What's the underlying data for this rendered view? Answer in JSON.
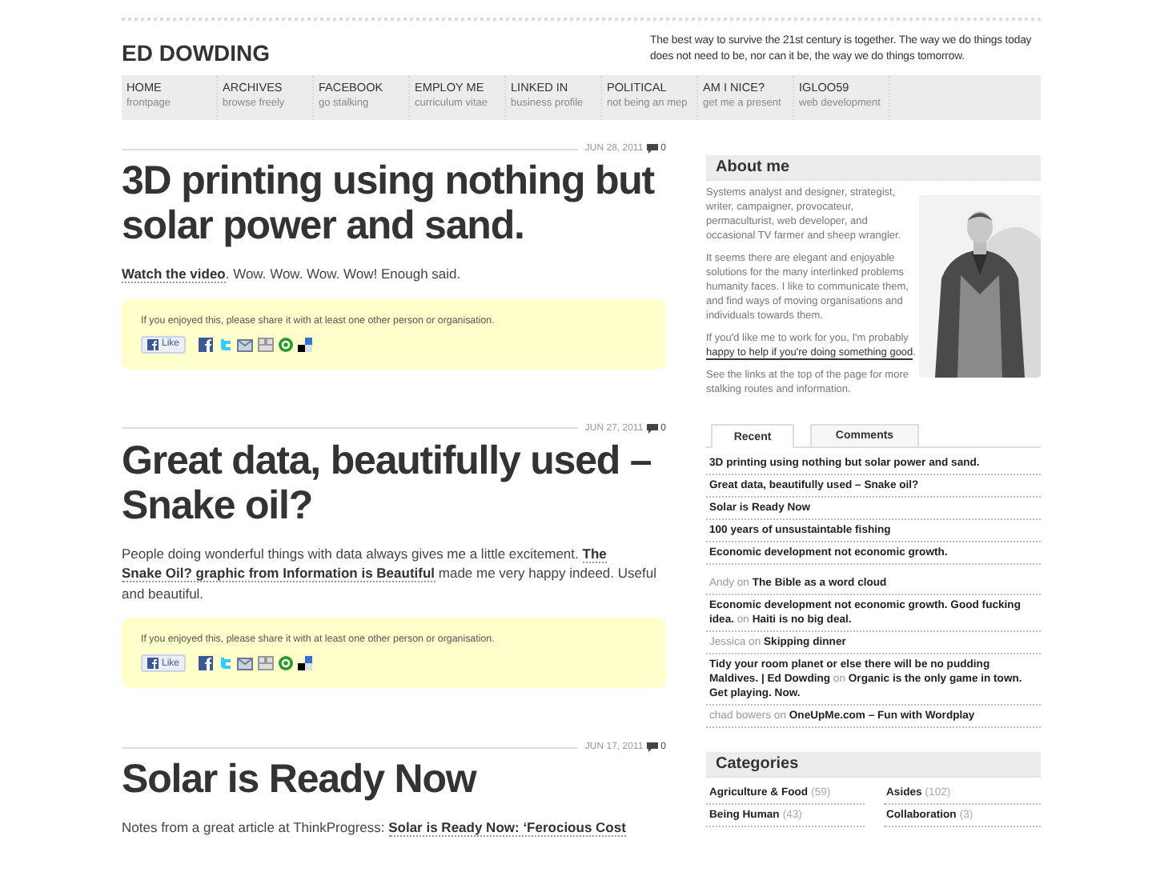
{
  "site": {
    "title": "ED DOWDING",
    "tagline": "The best way to survive the 21st century is together. The way we do things today does not need to be, nor can it be, the way we do things tomorrow."
  },
  "nav": [
    {
      "label": "HOME",
      "sub": "frontpage"
    },
    {
      "label": "ARCHIVES",
      "sub": "browse freely"
    },
    {
      "label": "FACEBOOK",
      "sub": "go stalking"
    },
    {
      "label": "EMPLOY ME",
      "sub": "curriculum vitae"
    },
    {
      "label": "LINKED IN",
      "sub": "business profile"
    },
    {
      "label": "POLITICAL",
      "sub": "not being an mep"
    },
    {
      "label": "AM I NICE?",
      "sub": "get me a present"
    },
    {
      "label": "IGLOO59",
      "sub": "web development"
    }
  ],
  "posts": [
    {
      "date": "JUN 28, 2011",
      "comments": "0",
      "title": "3D printing using nothing but solar power and sand.",
      "body": [
        {
          "text": "Watch the video",
          "link": true
        },
        {
          "text": ". Wow. Wow. Wow. Wow! Enough said.",
          "link": false
        }
      ],
      "share": {
        "text": "If you enjoyed this, please share it with at least one other person or organisation.",
        "like": "Like"
      }
    },
    {
      "date": "JUN 27, 2011",
      "comments": "0",
      "title": "Great data, beautifully used – Snake oil?",
      "body": [
        {
          "text": "People doing wonderful things with data always gives me a little excitement. ",
          "link": false
        },
        {
          "text": "The",
          "link": true
        },
        {
          "text": "Snake Oil? graphic from Information is Beautiful",
          "link": true
        },
        {
          "text": " made me very happy indeed. Useful and beautiful.",
          "link": false
        }
      ],
      "share": {
        "text": "If you enjoyed this, please share it with at least one other person or organisation.",
        "like": "Like"
      }
    },
    {
      "date": "JUN 17, 2011",
      "comments": "0",
      "title": "Solar is Ready Now",
      "body": [
        {
          "text": "Notes from a great article at ThinkProgress: ",
          "link": false
        },
        {
          "text": "Solar is Ready Now: ‘Ferocious Cost",
          "link": true
        }
      ]
    }
  ],
  "about": {
    "title": "About me",
    "paragraphs": [
      [
        {
          "text": "Systems analyst and designer, strategist, writer, campaigner, provocateur, permaculturist, web developer, and occasional TV farmer and sheep wrangler.",
          "link": false
        }
      ],
      [
        {
          "text": "It seems there are elegant and enjoyable solutions for the many interlinked problems humanity faces. I like to communicate them, and find ways of moving organisations and individuals towards them.",
          "link": false
        }
      ],
      [
        {
          "text": "If you'd like me to work for you, I'm probably ",
          "link": false
        },
        {
          "text": "happy to help if you're doing something good",
          "link": true
        },
        {
          "text": ".",
          "link": false
        }
      ],
      [
        {
          "text": "See the links at the top of the page for more stalking routes and information.",
          "link": false
        }
      ]
    ]
  },
  "tabs": [
    {
      "label": "Recent",
      "selected": true
    },
    {
      "label": "Comments",
      "selected": false
    }
  ],
  "recent_posts": [
    "3D printing using nothing but solar power and sand.",
    "Great data, beautifully used – Snake oil?",
    "Solar is Ready Now",
    "100 years of unsustaintable fishing",
    "Economic development not economic growth."
  ],
  "recent_comments": [
    [
      {
        "text": "Andy",
        "link": false
      },
      {
        "text": " on ",
        "link": false
      },
      {
        "text": "The Bible as a word cloud",
        "link": true
      }
    ],
    [
      {
        "text": "Economic development not economic growth. Good fucking",
        "link": true
      },
      {
        "text": "idea.",
        "link": true
      },
      {
        "text": " on ",
        "link": false
      },
      {
        "text": "Haiti is no big deal.",
        "link": true
      }
    ],
    [
      {
        "text": "Jessica",
        "link": false
      },
      {
        "text": " on ",
        "link": false
      },
      {
        "text": "Skipping dinner",
        "link": true
      }
    ],
    [
      {
        "text": "Tidy your room planet or else there will be no pudding",
        "link": true
      },
      {
        "text": "Maldives. | Ed Dowding",
        "link": true
      },
      {
        "text": " on ",
        "link": false
      },
      {
        "text": "Organic is the only game in town.",
        "link": true
      },
      {
        "text": "Get playing. Now.",
        "link": true
      }
    ],
    [
      {
        "text": "chad bowers",
        "link": false
      },
      {
        "text": " on ",
        "link": false
      },
      {
        "text": "OneUpMe.com – Fun with Wordplay",
        "link": true
      }
    ]
  ],
  "categories": {
    "title": "Categories",
    "items": [
      {
        "name": "Agriculture & Food",
        "count": "(59)"
      },
      {
        "name": "Asides",
        "count": "(102)"
      },
      {
        "name": "Being Human",
        "count": "(43)"
      },
      {
        "name": "Collaboration",
        "count": "(3)"
      }
    ]
  }
}
